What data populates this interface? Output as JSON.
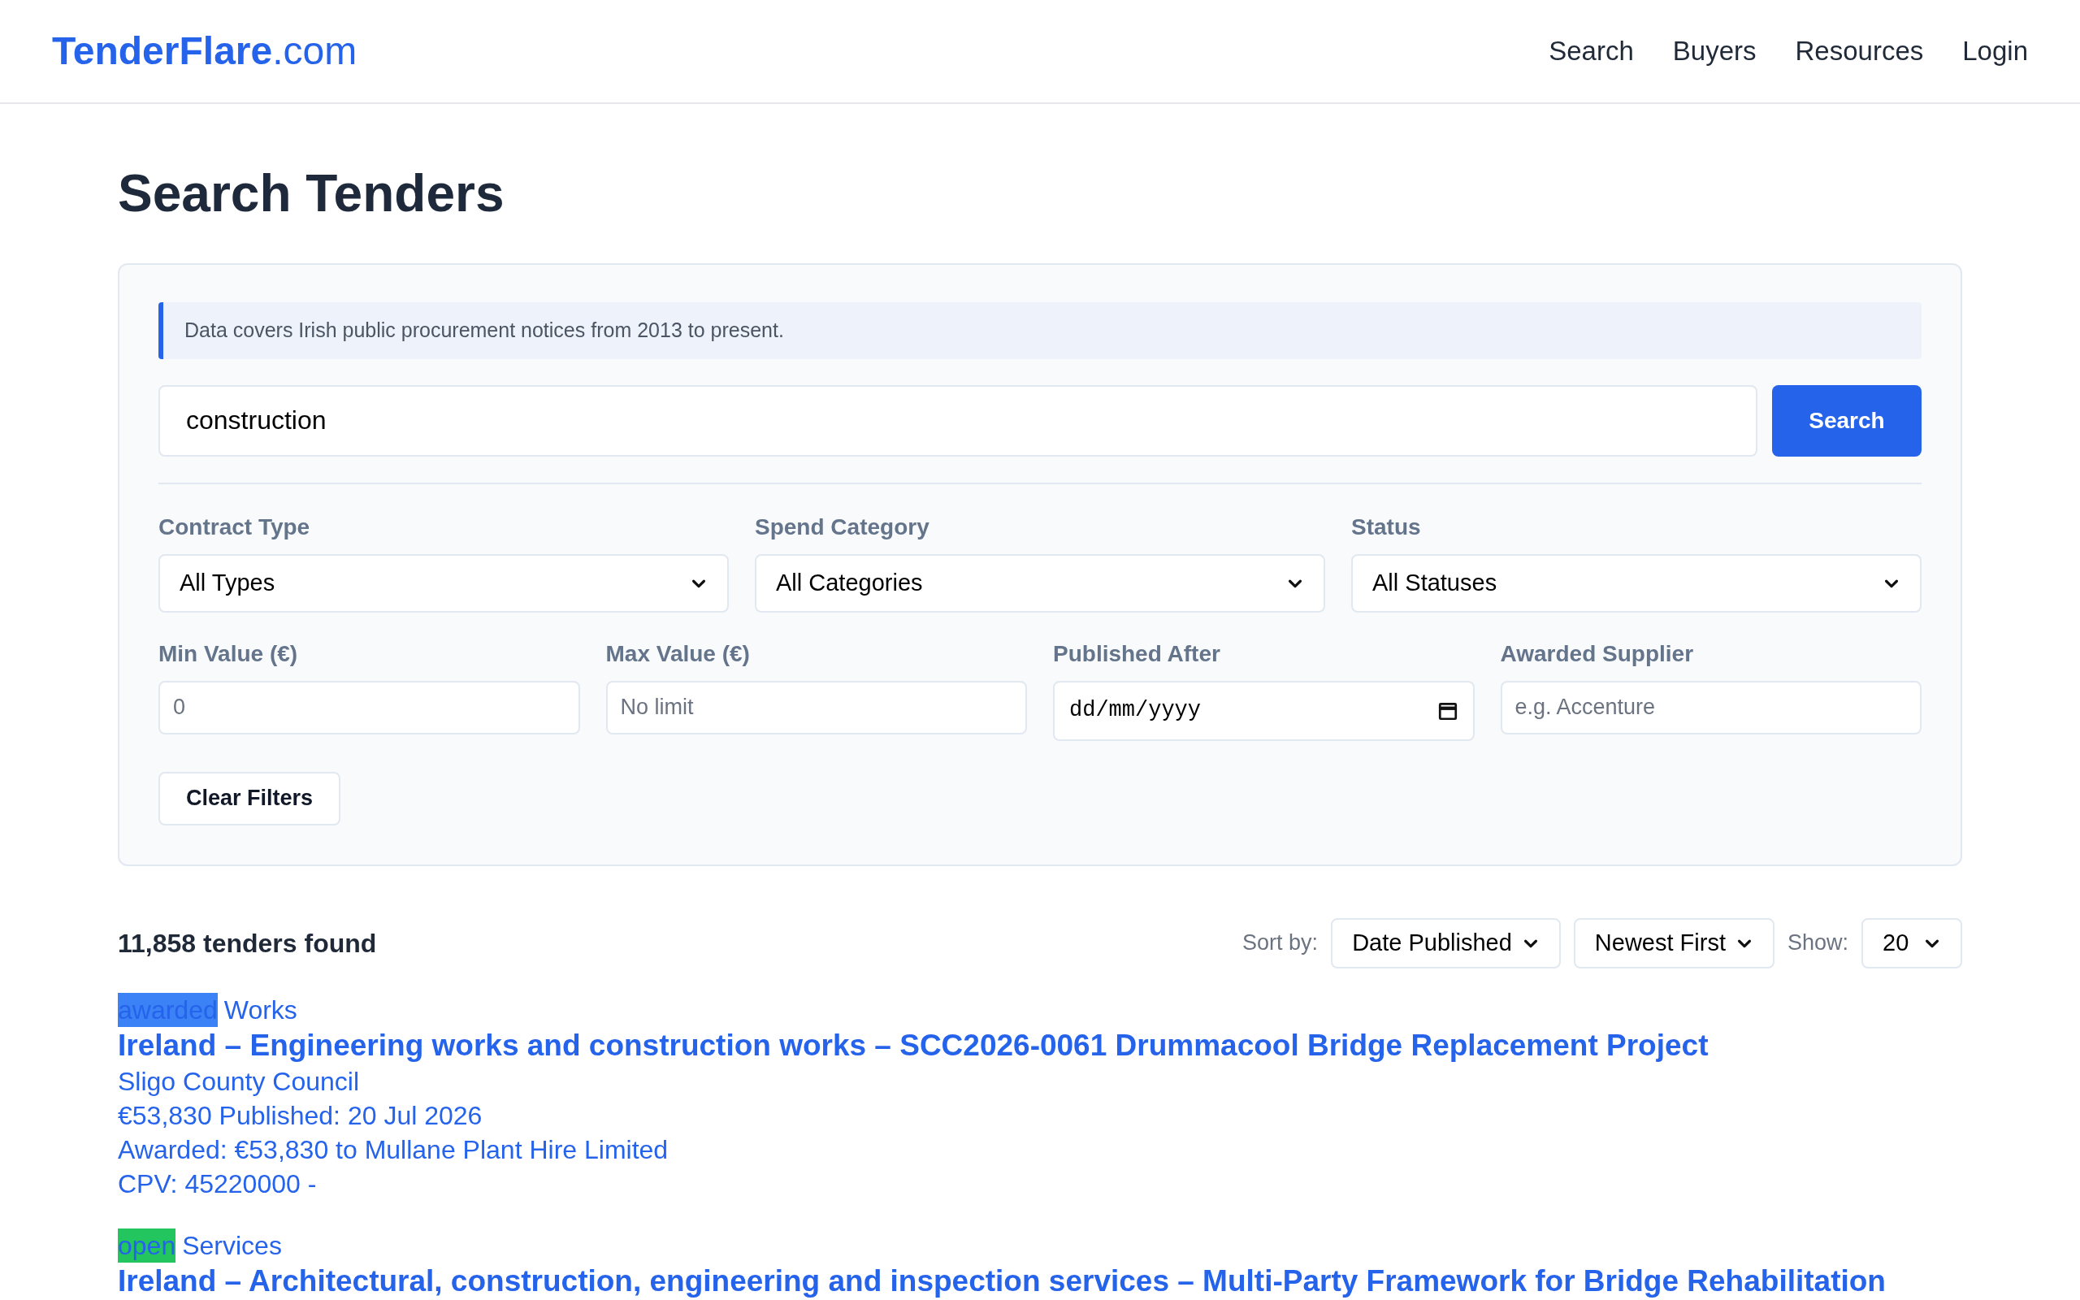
{
  "header": {
    "logo": {
      "name": "TenderFlare",
      "suffix": ".com"
    },
    "nav": [
      {
        "label": "Search"
      },
      {
        "label": "Buyers"
      },
      {
        "label": "Resources"
      },
      {
        "label": "Login"
      }
    ]
  },
  "page_title": "Search Tenders",
  "search_panel": {
    "notice": "Data covers Irish public procurement notices from 2013 to present.",
    "query": {
      "value": "construction"
    },
    "search_button": "Search",
    "selects": [
      {
        "label": "Contract Type",
        "value": "All Types"
      },
      {
        "label": "Spend Category",
        "value": "All Categories"
      },
      {
        "label": "Status",
        "value": "All Statuses"
      }
    ],
    "fields": [
      {
        "kind": "text",
        "label": "Min Value (€)",
        "placeholder": "0"
      },
      {
        "kind": "text",
        "label": "Max Value (€)",
        "placeholder": "No limit"
      },
      {
        "kind": "date",
        "label": "Published After",
        "value": "dd/mm/yyyy"
      },
      {
        "kind": "text",
        "label": "Awarded Supplier",
        "placeholder": "e.g. Accenture"
      }
    ],
    "clear_button": "Clear Filters"
  },
  "results_bar": {
    "count": "11,858 tenders found",
    "sort_label": "Sort by:",
    "sort_by": "Date Published",
    "order": "Newest First",
    "show_label": "Show:",
    "show": "20"
  },
  "results": [
    {
      "status": "awarded",
      "color": "#3b82f6",
      "category": "Works",
      "title": "Ireland – Engineering works and construction works – SCC2026-0061 Drummacool Bridge Replacement Project",
      "lines": [
        "Sligo County Council",
        "€53,830 Published: 20 Jul 2026",
        "Awarded: €53,830 to Mullane Plant Hire Limited",
        "CPV: 45220000 -"
      ]
    },
    {
      "status": "open",
      "color": "#22c55e",
      "category": "Services",
      "title": "Ireland – Architectural, construction, engineering and inspection services – Multi-Party Framework for Bridge Rehabilitation"
    }
  ]
}
